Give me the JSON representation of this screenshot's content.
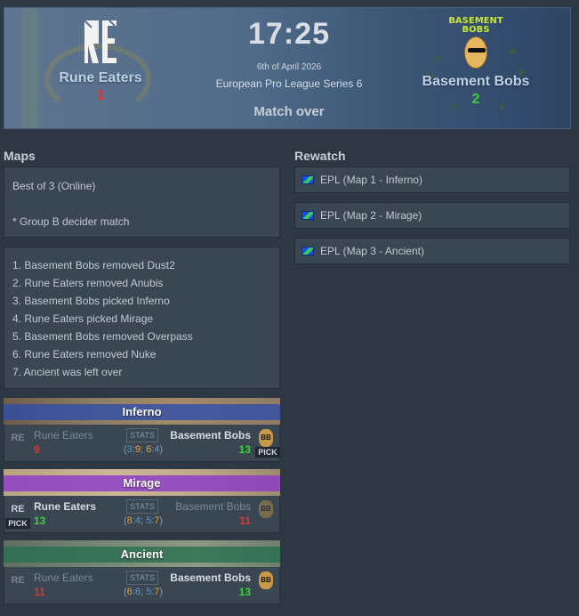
{
  "header": {
    "time": "17:25",
    "date": "6th of April 2026",
    "event": "European Pro League Series 6",
    "status": "Match over",
    "team1": {
      "name": "Rune Eaters",
      "score": "1",
      "logo_text": "RE"
    },
    "team2": {
      "name": "Basement Bobs",
      "score": "2",
      "logo_text": "BASEMENT BOBS"
    }
  },
  "maps_section": {
    "title": "Maps",
    "format": "Best of 3 (Online)",
    "note": "* Group B decider match",
    "veto": [
      "1. Basement Bobs removed Dust2",
      "2. Rune Eaters removed Anubis",
      "3. Basement Bobs picked Inferno",
      "4. Rune Eaters picked Mirage",
      "5. Basement Bobs removed Overpass",
      "6. Rune Eaters removed Nuke",
      "7. Ancient was left over"
    ]
  },
  "rewatch": {
    "title": "Rewatch",
    "items": [
      "EPL (Map 1 - Inferno)",
      "EPL (Map 2 - Mirage)",
      "EPL (Map 3 - Ancient)"
    ]
  },
  "maps": [
    {
      "name": "Inferno",
      "team1": "Rune Eaters",
      "team1_score": "9",
      "team2": "Basement Bobs",
      "team2_score": "13",
      "stats_label": "STATS",
      "open": "(",
      "h1a": "3",
      "sep1": ":",
      "h1b": "9",
      "semi": "; ",
      "h2a": "6",
      "sep2": ":",
      "h2b": "4",
      "close": ")",
      "pick_label": "PICK"
    },
    {
      "name": "Mirage",
      "team1": "Rune Eaters",
      "team1_score": "13",
      "team2": "Basement Bobs",
      "team2_score": "11",
      "stats_label": "STATS",
      "open": "(",
      "h1a": "8",
      "sep1": ":",
      "h1b": "4",
      "semi": "; ",
      "h2a": "5",
      "sep2": ":",
      "h2b": "7",
      "close": ")",
      "pick_label": "PICK"
    },
    {
      "name": "Ancient",
      "team1": "Rune Eaters",
      "team1_score": "11",
      "team2": "Basement Bobs",
      "team2_score": "13",
      "stats_label": "STATS",
      "open": "(",
      "h1a": "6",
      "sep1": ":",
      "h1b": "6",
      "semi": "; ",
      "h2a": "5",
      "sep2": ":",
      "h2b": "7",
      "close": ")"
    }
  ],
  "colors": {
    "win": "#3ecf3e",
    "lose": "#d63838",
    "ct": "#5b9ad6",
    "t": "#e0a43c"
  }
}
